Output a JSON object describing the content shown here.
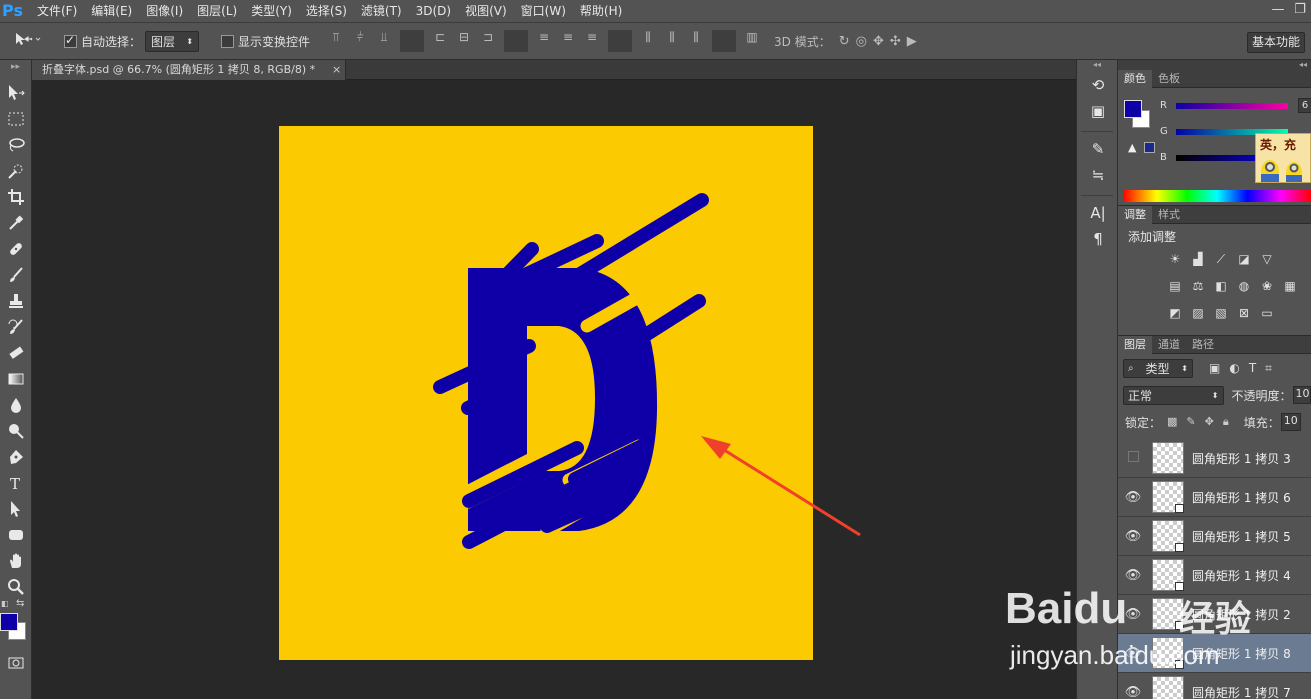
{
  "app": {
    "logo": "Ps"
  },
  "menu": [
    "文件(F)",
    "编辑(E)",
    "图像(I)",
    "图层(L)",
    "类型(Y)",
    "选择(S)",
    "滤镜(T)",
    "3D(D)",
    "视图(V)",
    "窗口(W)",
    "帮助(H)"
  ],
  "window_controls": {
    "minimize": "—",
    "restore": "❐"
  },
  "options": {
    "auto_select_label": "自动选择：",
    "auto_select_checked": true,
    "auto_select_value": "图层",
    "show_transform_label": "显示变换控件",
    "show_transform_checked": false,
    "mode_3d_label": "3D 模式：",
    "workspace_button": "基本功能"
  },
  "document_tab": {
    "title": "折叠字体.psd @ 66.7% (圆角矩形 1 拷贝 8, RGB/8) *",
    "close": "×"
  },
  "canvas": {
    "background": "#fcca00",
    "letter_color": "#0e00a6",
    "arrow_color": "#f0402c"
  },
  "color_panel": {
    "tabs": [
      "颜色",
      "色板"
    ],
    "foreground": "#0e00a6",
    "background": "#ffffff",
    "sliders": [
      {
        "label": "R",
        "value": "6"
      },
      {
        "label": "G",
        "value": ""
      },
      {
        "label": "B",
        "value": ""
      }
    ],
    "sticker_text": "英，充"
  },
  "adjustments_panel": {
    "tabs": [
      "调整",
      "样式"
    ],
    "title": "添加调整"
  },
  "layers_panel": {
    "tabs": [
      "图层",
      "通道",
      "路径"
    ],
    "filter_kind": "类型",
    "blend_mode": "正常",
    "opacity_label": "不透明度：",
    "opacity_value": "10",
    "lock_label": "锁定：",
    "fill_label": "填充：",
    "fill_value": "10",
    "layers": [
      {
        "name": "圆角矩形 1 拷贝 3",
        "visible": false,
        "selected": false
      },
      {
        "name": "圆角矩形 1 拷贝 6",
        "visible": true,
        "selected": false
      },
      {
        "name": "圆角矩形 1 拷贝 5",
        "visible": true,
        "selected": false
      },
      {
        "name": "圆角矩形 1 拷贝 4",
        "visible": true,
        "selected": false
      },
      {
        "name": "圆角矩形 1 拷贝 2",
        "visible": true,
        "selected": false
      },
      {
        "name": "圆角矩形 1 拷贝 8",
        "visible": true,
        "selected": true
      },
      {
        "name": "圆角矩形 1 拷贝 7",
        "visible": true,
        "selected": false
      }
    ]
  },
  "watermark": {
    "brand": "Baidu",
    "cn": "经验",
    "url": "jingyan.baidu.com"
  }
}
